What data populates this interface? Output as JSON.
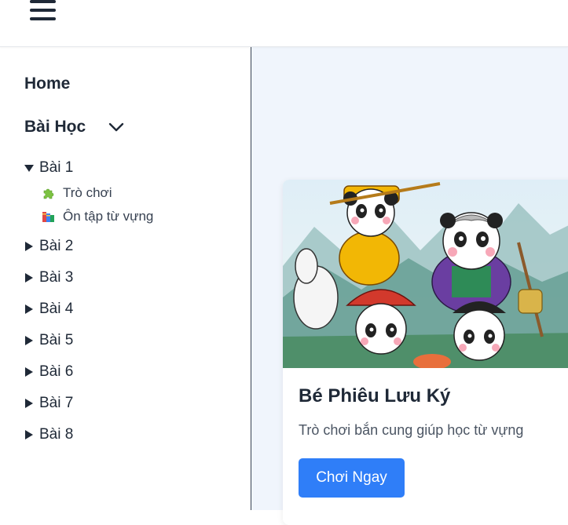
{
  "header": {
    "menu_icon": "hamburger-menu-icon"
  },
  "sidebar": {
    "home_label": "Home",
    "lessons_label": "Bài Học",
    "lessons_chevron_icon": "chevron-down-icon",
    "lessons": [
      {
        "label": "Bài 1",
        "expanded": true,
        "children": [
          {
            "label": "Trò chơi",
            "icon": "puzzle-piece-icon"
          },
          {
            "label": "Ôn tập từ vựng",
            "icon": "books-icon"
          }
        ]
      },
      {
        "label": "Bài 2",
        "expanded": false
      },
      {
        "label": "Bài 3",
        "expanded": false
      },
      {
        "label": "Bài 4",
        "expanded": false
      },
      {
        "label": "Bài 5",
        "expanded": false
      },
      {
        "label": "Bài 6",
        "expanded": false
      },
      {
        "label": "Bài 7",
        "expanded": false
      },
      {
        "label": "Bài 8",
        "expanded": false
      }
    ]
  },
  "main": {
    "background_color": "#f0f5fc",
    "game_card": {
      "image": "panda-journey-to-the-west-illustration",
      "title": "Bé Phiêu Lưu Ký",
      "description": "Trò chơi bắn cung giúp học từ vựng",
      "play_button_label": "Chơi Ngay",
      "accent_color": "#2f7ef8"
    }
  }
}
